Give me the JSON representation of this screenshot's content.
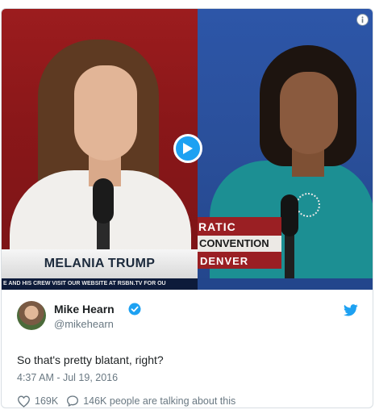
{
  "video": {
    "left_lower_third": "MELANIA TRUMP",
    "left_ticker": "E AND HIS CREW    VISIT OUR WEBSITE AT RSBN.TV FOR OU",
    "right_lower_third": {
      "line1": "RATIC",
      "line2": "CONVENTION",
      "line3": "DENVER"
    }
  },
  "tweet": {
    "author_name": "Mike Hearn",
    "author_handle": "@mikehearn",
    "text": "So that's pretty blatant, right?",
    "timestamp": "4:37 AM - Jul 19, 2016",
    "likes": "169K",
    "talking": "146K people are talking about this"
  },
  "colors": {
    "accent": "#1da1f2",
    "text_primary": "#1c2022",
    "text_secondary": "#697882"
  },
  "icons": [
    "play-icon",
    "info-icon",
    "verified-badge-icon",
    "twitter-bird-icon",
    "heart-icon",
    "speech-bubble-icon"
  ]
}
